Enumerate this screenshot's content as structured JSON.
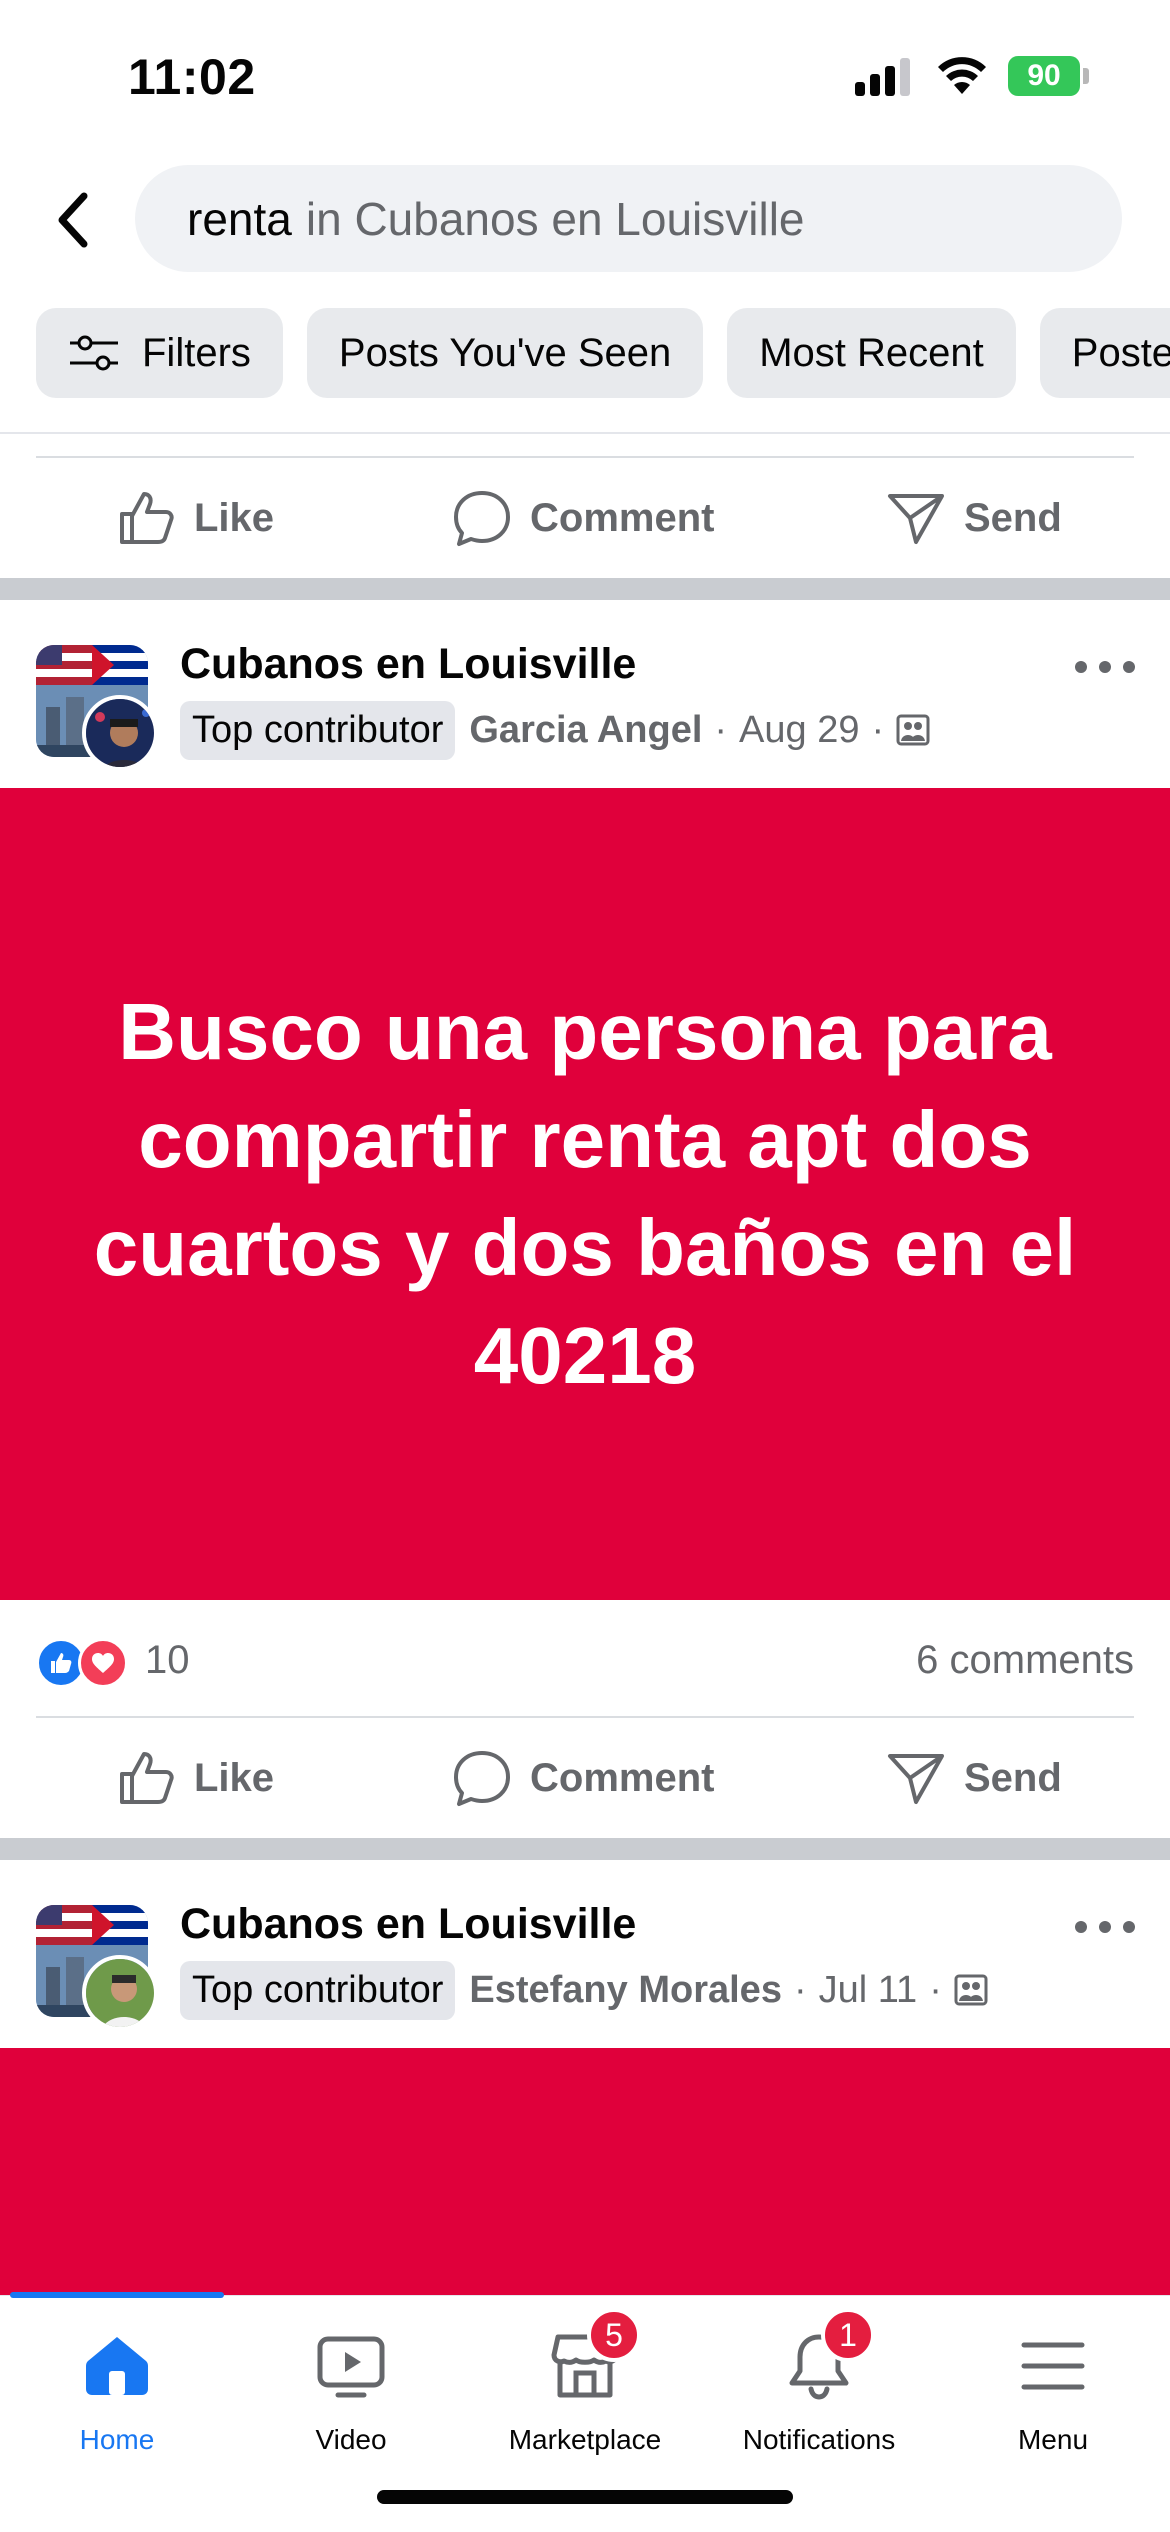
{
  "status_bar": {
    "time": "11:02",
    "battery": "90"
  },
  "search": {
    "query": "renta",
    "scope": "in Cubanos en Louisville"
  },
  "chips": [
    {
      "label": "Filters",
      "icon": "sliders-icon"
    },
    {
      "label": "Posts You've Seen"
    },
    {
      "label": "Most Recent"
    },
    {
      "label": "Poste"
    }
  ],
  "actions": {
    "like": "Like",
    "comment": "Comment",
    "send": "Send"
  },
  "posts": [
    {
      "group": "Cubanos en Louisville",
      "badge": "Top contributor",
      "author": "Garcia Angel",
      "date": "Aug 29",
      "text": "Busco una persona para compartir renta apt dos cuartos y dos baños en el 40218",
      "background": "#e0003b",
      "reactions_count": "10",
      "comments": "6 comments"
    },
    {
      "group": "Cubanos en Louisville",
      "badge": "Top contributor",
      "author": "Estefany Morales",
      "date": "Jul 11",
      "background": "#e0003b"
    }
  ],
  "nav": {
    "home": "Home",
    "video": "Video",
    "marketplace": "Marketplace",
    "marketplace_badge": "5",
    "notifications": "Notifications",
    "notifications_badge": "1",
    "menu": "Menu"
  },
  "colors": {
    "accent": "#1877f2",
    "post_bg": "#e0003b",
    "badge_red": "#e41e3f"
  }
}
